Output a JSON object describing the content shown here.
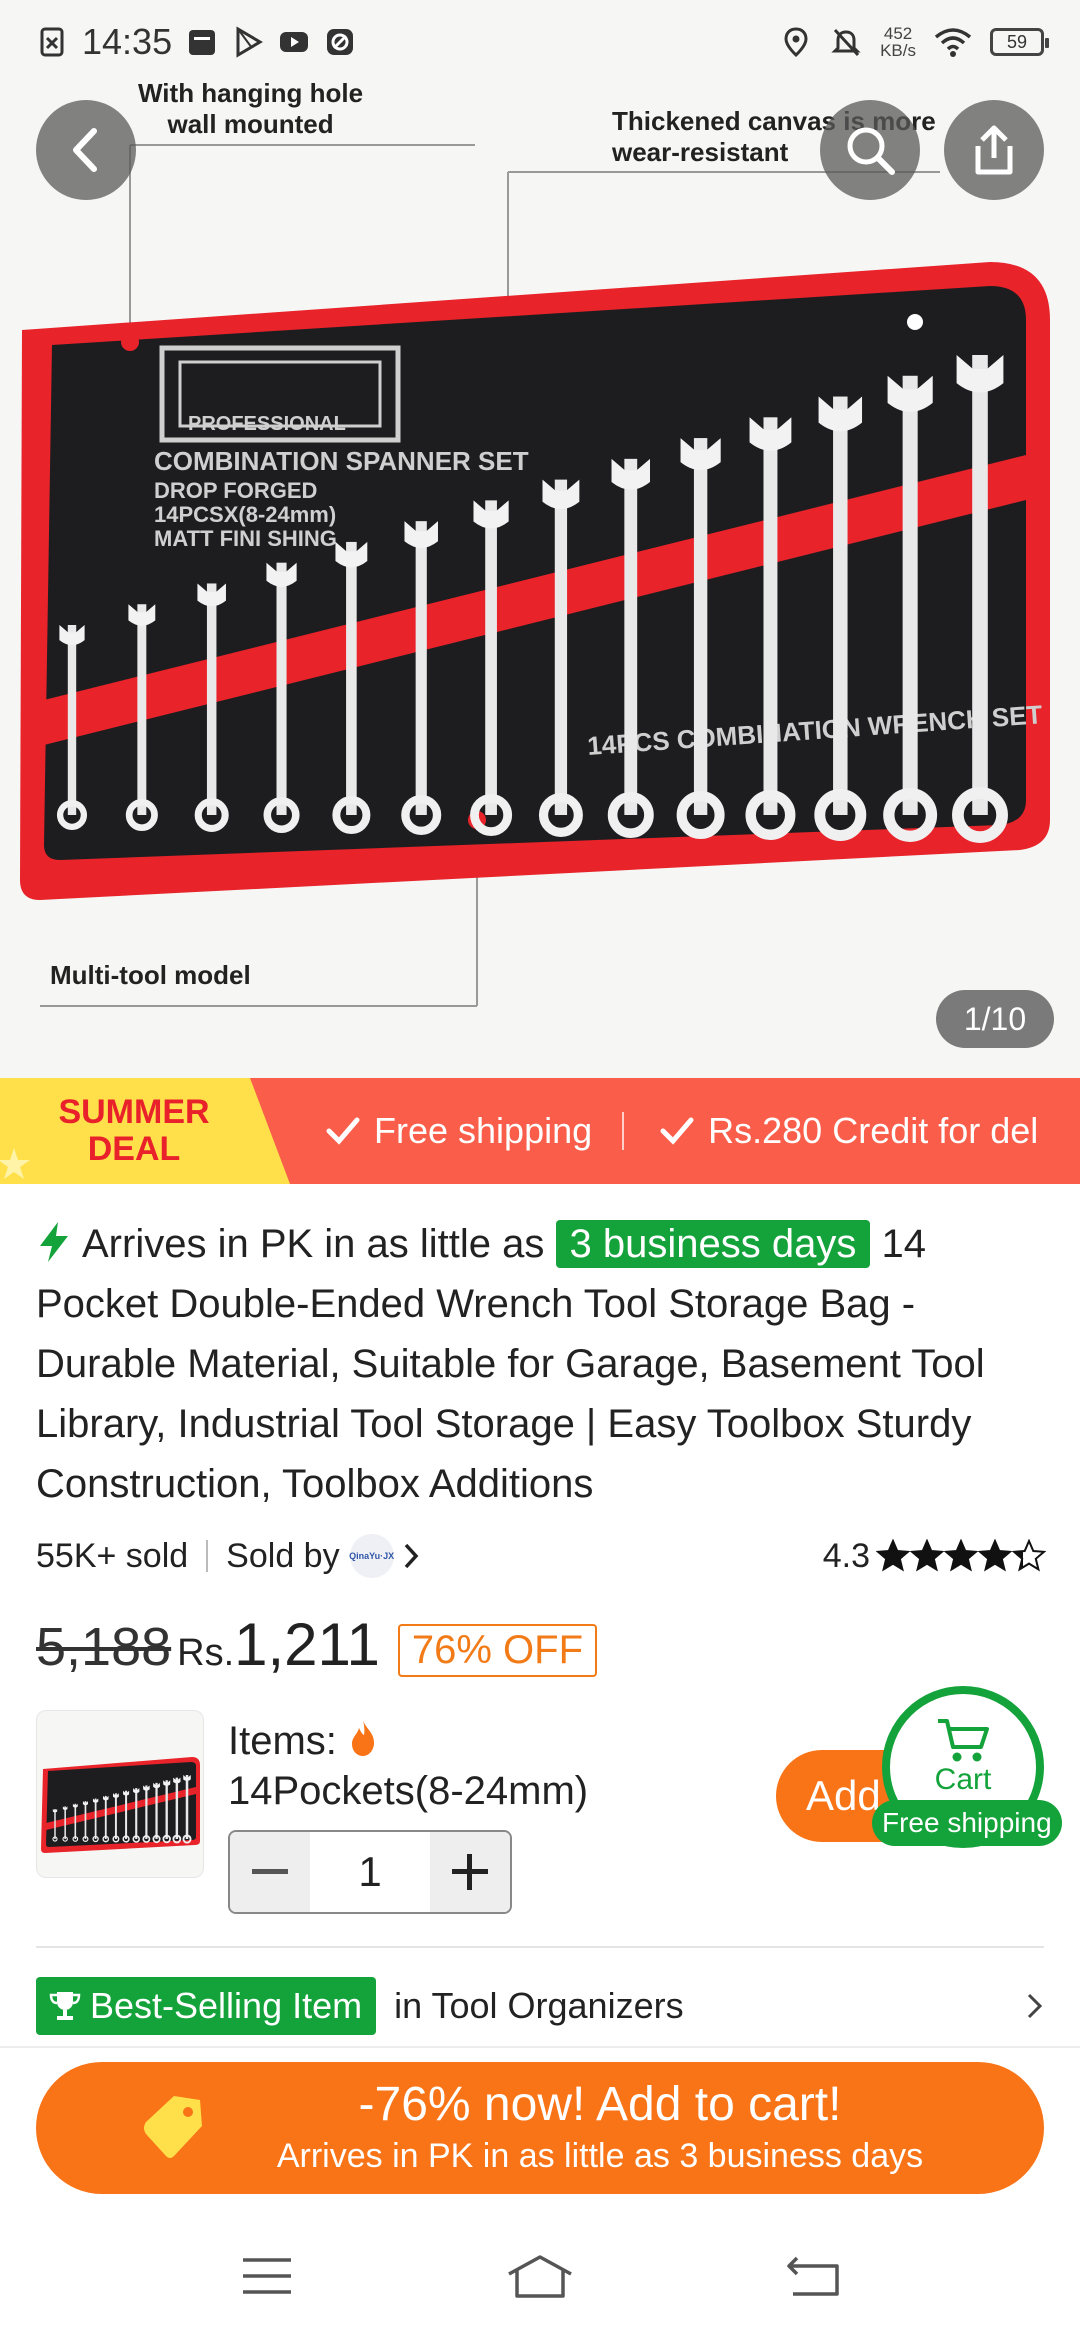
{
  "status_bar": {
    "time": "14:35",
    "net_speed_value": "452",
    "net_speed_unit": "KB/s",
    "battery": "59"
  },
  "hero": {
    "callout_hanging": "With hanging hole\nwall mounted",
    "callout_canvas": "Thickened canvas is more\nwear-resistant",
    "callout_multitool": "Multi-tool model",
    "product_print": {
      "brand": "PROFESSIONAL",
      "line1": "COMBINATION SPANNER SET",
      "line2": "DROP FORGED",
      "line3": "14PCSX(8-24mm)",
      "line4": "MATT FINI SHING",
      "strip_text": "14PCS COMBINATION WRENCH SET"
    },
    "page_indicator": "1/10"
  },
  "promo": {
    "badge_line1": "SUMMER",
    "badge_line2": "DEAL",
    "item1": "Free shipping",
    "item2": "Rs.280 Credit for del",
    "accent": "#fa5e4b"
  },
  "title": {
    "arrives_prefix": "Arrives in PK in as little as",
    "arrives_days": "3 business days",
    "product_name": "14 Pocket Double-Ended Wrench Tool Storage Bag - Durable Material, Suitable for Garage, Basement Tool Library, Industrial Tool Storage | Easy Toolbox Sturdy Construction, Toolbox Additions"
  },
  "meta": {
    "sold": "55K+ sold",
    "sold_by": "Sold by",
    "seller_logo_text": "QinaYu·JX",
    "rating": "4.3",
    "rating_value": 4.3,
    "rating_max": 5
  },
  "price": {
    "old": "5,188",
    "currency": "Rs.",
    "new": "1,211",
    "discount": "76% OFF"
  },
  "sku": {
    "label": "Items:",
    "value": "14Pockets(8-24mm)",
    "quantity": "1",
    "add_label": "Add",
    "cart_label": "Cart",
    "cart_shipping": "Free shipping"
  },
  "bestsell": {
    "badge": "Best-Selling Item",
    "category": "in Tool Organizers"
  },
  "cta": {
    "main": "-76% now! Add to cart!",
    "sub": "Arrives in PK in as little as 3 business days"
  },
  "colors": {
    "orange": "#f97317",
    "green": "#14a33a",
    "promo_red": "#fa5e4b"
  },
  "icons": [
    "back-icon",
    "search-icon",
    "share-icon",
    "bolt-icon",
    "chevron-right-icon",
    "star-icon",
    "cart-icon",
    "trophy-icon",
    "price-tag-icon",
    "menu-icon",
    "home-icon",
    "back-nav-icon"
  ]
}
